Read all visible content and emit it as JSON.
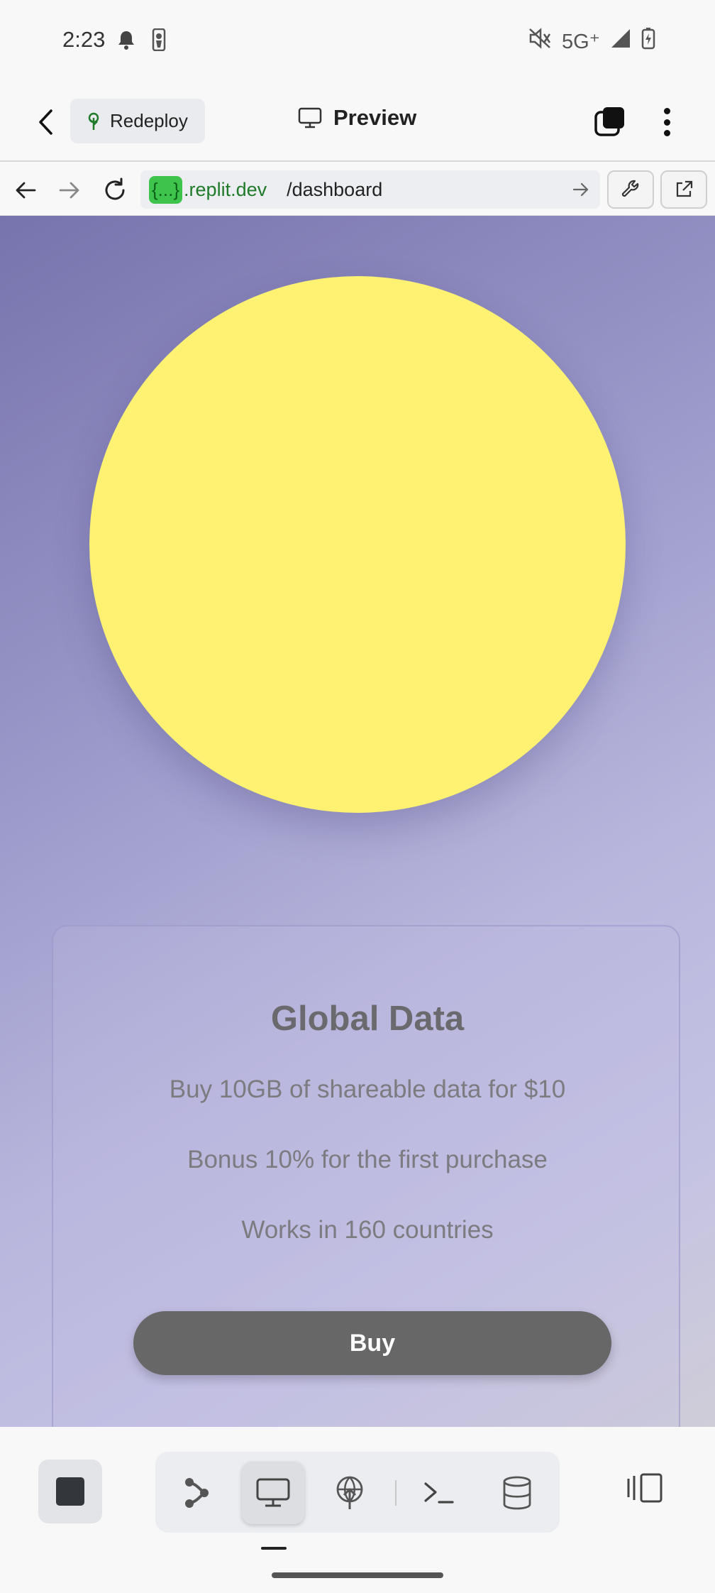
{
  "status_bar": {
    "time": "2:23",
    "network": "5G⁺",
    "icons": [
      "bell-icon",
      "basketball-icon",
      "mute-icon",
      "signal-icon",
      "battery-charging-icon"
    ]
  },
  "header": {
    "back_icon": "chevron-left-icon",
    "redeploy_label": "Redeploy",
    "redeploy_icon": "tree-icon",
    "title": "Preview",
    "title_icon": "monitor-icon",
    "tabs_icon": "tabs-icon",
    "menu_icon": "more-vertical-icon"
  },
  "url_bar": {
    "chip": "{...}",
    "domain": ".replit.dev",
    "path": "/dashboard",
    "icons": [
      "arrow-left-icon",
      "arrow-right-icon",
      "reload-icon",
      "go-arrow-icon",
      "wrench-icon",
      "external-link-icon"
    ]
  },
  "page": {
    "sun_color": "#fff272",
    "card": {
      "title": "Global Data",
      "line1": "Buy 10GB of shareable data for $10",
      "line2": "Bonus 10% for the first purchase",
      "line3": "Works in 160 countries",
      "buy_label": "Buy"
    }
  },
  "bottom_bar": {
    "buttons": [
      "stop-icon",
      "git-branch-icon",
      "monitor-icon",
      "deploy-globe-icon",
      "terminal-icon",
      "database-icon",
      "panel-toggle-icon"
    ],
    "active": "monitor-icon"
  }
}
